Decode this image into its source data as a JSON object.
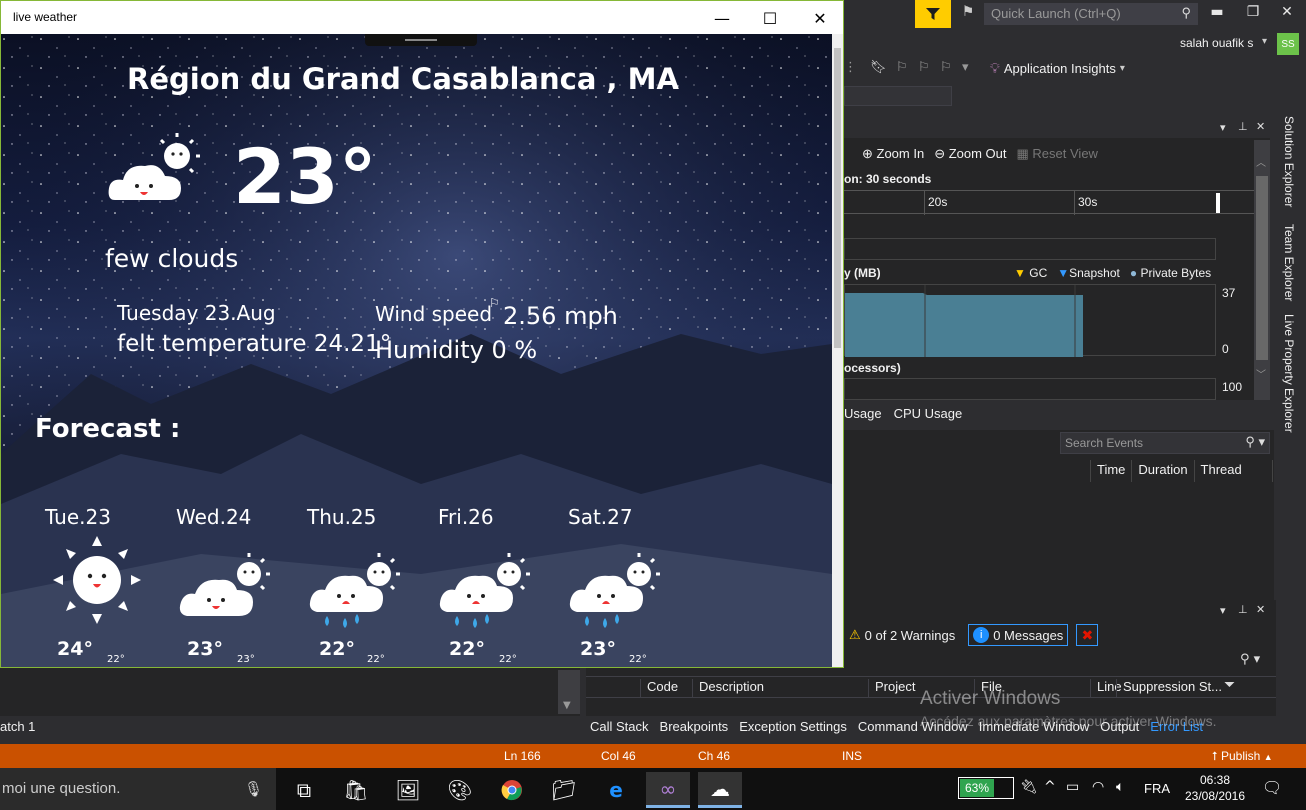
{
  "weather_app": {
    "window_title": "live weather",
    "region": "Région du Grand Casablanca , MA",
    "temperature": "23°",
    "description": "few clouds",
    "date": "Tuesday 23.Aug",
    "felt": "felt temperature 24.21°",
    "wind_label": "Wind speed",
    "wind_value": "2.56 mph",
    "humidity": "Humidity  0 %",
    "forecast_title": "Forecast :",
    "forecast": [
      {
        "day": "Tue.23",
        "hi": "24°",
        "lo": "22°",
        "icon": "sunny-icon"
      },
      {
        "day": "Wed.24",
        "hi": "23°",
        "lo": "23°",
        "icon": "partly-cloudy-icon"
      },
      {
        "day": "Thu.25",
        "hi": "22°",
        "lo": "22°",
        "icon": "rain-icon"
      },
      {
        "day": "Fri.26",
        "hi": "22°",
        "lo": "22°",
        "icon": "rain-icon"
      },
      {
        "day": "Sat.27",
        "hi": "23°",
        "lo": "22°",
        "icon": "rain-icon"
      }
    ]
  },
  "vs": {
    "quick_launch_placeholder": "Quick Launch (Ctrl+Q)",
    "user": "salah ouafik s",
    "avatar": "SS",
    "app_insights": "Application Insights",
    "zoom_in": "Zoom In",
    "zoom_out": "Zoom Out",
    "reset_view": "Reset View",
    "session": "on: 30 seconds",
    "ruler_labels": [
      "20s",
      "30s"
    ],
    "memory_title": "y (MB)",
    "legend": [
      "GC",
      "Snapshot",
      "Private Bytes"
    ],
    "mem_axis_max": "37",
    "mem_axis_min": "0",
    "cpu_title": "ocessors)",
    "cpu_axis_max": "100",
    "diag_tabs": [
      "Usage",
      "CPU Usage"
    ],
    "search_events_placeholder": "Search Events",
    "event_columns": [
      "Time",
      "Duration",
      "Thread"
    ],
    "side_tabs": [
      "Solution Explorer",
      "Team Explorer",
      "Live Property Explorer"
    ],
    "warnings": "0 of 2 Warnings",
    "messages": "0 Messages",
    "error_columns": [
      "Code",
      "Description",
      "Project",
      "File",
      "Line",
      "Suppression St..."
    ],
    "watch_tab": "atch 1",
    "tool_tabs": [
      "Call Stack",
      "Breakpoints",
      "Exception Settings",
      "Command Window",
      "Immediate Window",
      "Output",
      "Error List"
    ],
    "activate_title": "Activer Windows",
    "activate_sub": "Accédez aux paramètres pour activer Windows.",
    "status": {
      "ln": "Ln 166",
      "col": "Col 46",
      "ch": "Ch 46",
      "ins": "INS",
      "publish": "Publish"
    }
  },
  "taskbar": {
    "cortana": "moi une question.",
    "battery": "63%",
    "lang": "FRA",
    "time": "06:38",
    "date": "23/08/2016"
  }
}
